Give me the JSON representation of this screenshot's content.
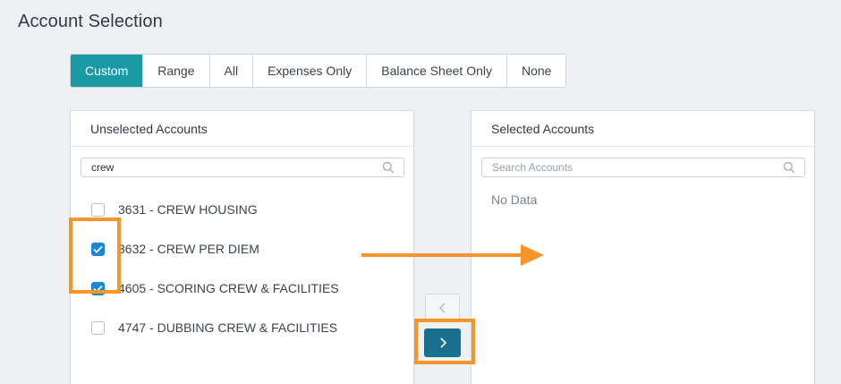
{
  "page": {
    "title": "Account Selection"
  },
  "selection_modes": [
    {
      "label": "Custom",
      "active": true
    },
    {
      "label": "Range",
      "active": false
    },
    {
      "label": "All",
      "active": false
    },
    {
      "label": "Expenses Only",
      "active": false
    },
    {
      "label": "Balance Sheet Only",
      "active": false
    },
    {
      "label": "None",
      "active": false
    }
  ],
  "unselected": {
    "header": "Unselected Accounts",
    "search_value": "crew",
    "search_placeholder": "Search Accounts",
    "items": [
      {
        "label": "3631 - CREW HOUSING",
        "checked": false
      },
      {
        "label": "3632 - CREW PER DIEM",
        "checked": true
      },
      {
        "label": "4605 - SCORING CREW & FACILITIES",
        "checked": true
      },
      {
        "label": "4747 - DUBBING CREW & FACILITIES",
        "checked": false
      }
    ]
  },
  "selected": {
    "header": "Selected Accounts",
    "search_value": "",
    "search_placeholder": "Search Accounts",
    "empty_text": "No Data"
  },
  "colors": {
    "accent": "#1b9aa6",
    "checkbox": "#1a86d8",
    "move_button": "#1a6e8e",
    "highlight": "#f7952b"
  },
  "icons": {
    "search": "search-icon",
    "move_left": "chevron-left-icon",
    "move_right": "chevron-right-icon",
    "pointer": "arrow-right-icon"
  }
}
